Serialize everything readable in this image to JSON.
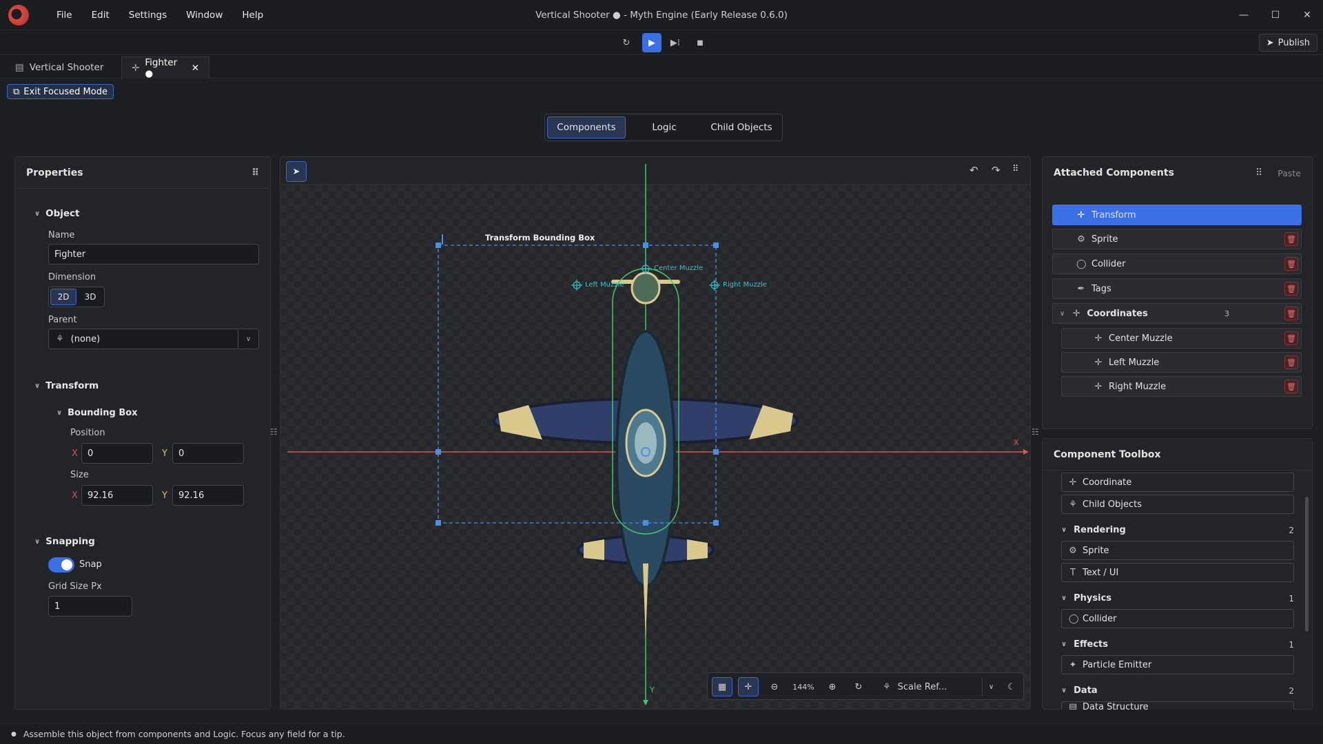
{
  "window": {
    "title": "Vertical Shooter ● - Myth Engine (Early Release 0.6.0)",
    "menu": [
      "File",
      "Edit",
      "Settings",
      "Window",
      "Help"
    ],
    "publish": "Publish"
  },
  "tabs": [
    {
      "label": "Vertical Shooter"
    },
    {
      "label": "Fighter ●"
    }
  ],
  "exit_focused": "Exit Focused Mode",
  "segments": [
    "Components",
    "Logic",
    "Child Objects"
  ],
  "properties": {
    "title": "Properties",
    "object_section": "Object",
    "name_label": "Name",
    "name_value": "Fighter",
    "dimension_label": "Dimension",
    "dim_2d": "2D",
    "dim_3d": "3D",
    "parent_label": "Parent",
    "parent_value": "(none)",
    "transform_section": "Transform",
    "bbox_section": "Bounding Box",
    "position_label": "Position",
    "pos_x": "0",
    "pos_y": "0",
    "size_label": "Size",
    "size_x": "92.16",
    "size_y": "92.16",
    "x_axis": "X",
    "y_axis": "Y",
    "snapping_section": "Snapping",
    "snap_label": "Snap",
    "grid_label": "Grid Size Px",
    "grid_value": "1"
  },
  "viewport": {
    "bbox_label": "Transform Bounding Box",
    "center_muzzle": "Center Muzzle",
    "left_muzzle": "Left Muzzle",
    "right_muzzle": "Right Muzzle",
    "axis_x": "X",
    "axis_y": "Y",
    "zoom": "144%",
    "scale_ref": "Scale Ref..."
  },
  "attached": {
    "title": "Attached Components",
    "paste": "Paste",
    "items": [
      {
        "label": "Transform",
        "icon": "move-icon"
      },
      {
        "label": "Sprite",
        "icon": "sprite-icon"
      },
      {
        "label": "Collider",
        "icon": "shield-icon"
      },
      {
        "label": "Tags",
        "icon": "tag-icon"
      },
      {
        "label": "Coordinates",
        "icon": "move-icon",
        "count": "3"
      },
      {
        "label": "Center Muzzle",
        "icon": "move-icon"
      },
      {
        "label": "Left Muzzle",
        "icon": "move-icon"
      },
      {
        "label": "Right Muzzle",
        "icon": "move-icon"
      }
    ]
  },
  "toolbox": {
    "title": "Component Toolbox",
    "coordinate": "Coordinate",
    "child_objects": "Child Objects",
    "rendering": "Rendering",
    "rendering_count": "2",
    "sprite": "Sprite",
    "text_ui": "Text / UI",
    "physics": "Physics",
    "physics_count": "1",
    "collider": "Collider",
    "effects": "Effects",
    "effects_count": "1",
    "particle": "Particle Emitter",
    "data": "Data",
    "data_count": "2",
    "data_structure": "Data Structure"
  },
  "status": "Assemble this object from components and Logic. Focus any field for a tip.",
  "colors": {
    "accent": "#3b6fe6",
    "x_axis": "#e05252",
    "y_axis": "#4cc36a",
    "bbox": "#4a90e2",
    "muzzle": "#2ec5c5"
  }
}
